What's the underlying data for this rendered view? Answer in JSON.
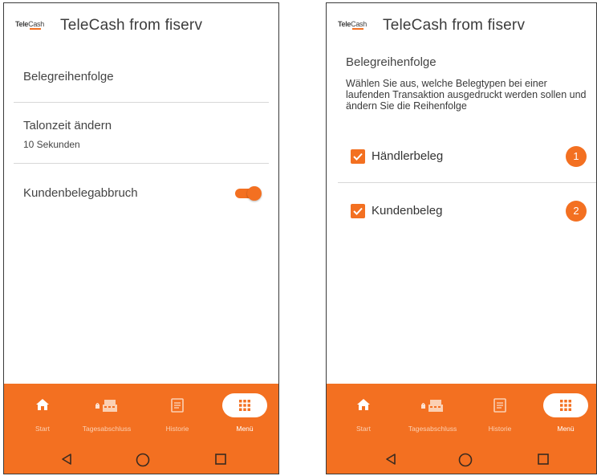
{
  "brand": {
    "logo_word1": "Tele",
    "logo_word2": "Cash",
    "title": "TeleCash from fiserv",
    "accent": "#f37021"
  },
  "left_screen": {
    "items": [
      {
        "title": "Belegreihenfolge"
      },
      {
        "title": "Talonzeit ändern",
        "subtitle": "10 Sekunden"
      },
      {
        "title": "Kundenbelegabbruch",
        "toggle_on": true
      }
    ]
  },
  "right_screen": {
    "heading": "Belegreihenfolge",
    "description": "Wählen Sie aus, welche Belegtypen bei einer laufenden Transaktion ausgedruckt werden sollen und ändern Sie die Reihenfolge",
    "receipts": [
      {
        "label": "Händlerbeleg",
        "checked": true,
        "order": "1"
      },
      {
        "label": "Kundenbeleg",
        "checked": true,
        "order": "2"
      }
    ]
  },
  "bottom_nav": [
    {
      "label": "Start",
      "icon": "home-icon"
    },
    {
      "label": "Tagesabschluss",
      "icon": "cash-register-icon"
    },
    {
      "label": "Historie",
      "icon": "document-icon"
    },
    {
      "label": "Menü",
      "icon": "grid-icon",
      "active": true
    }
  ],
  "system_nav": [
    {
      "icon": "back-icon"
    },
    {
      "icon": "home-circle-icon"
    },
    {
      "icon": "recents-icon"
    }
  ]
}
